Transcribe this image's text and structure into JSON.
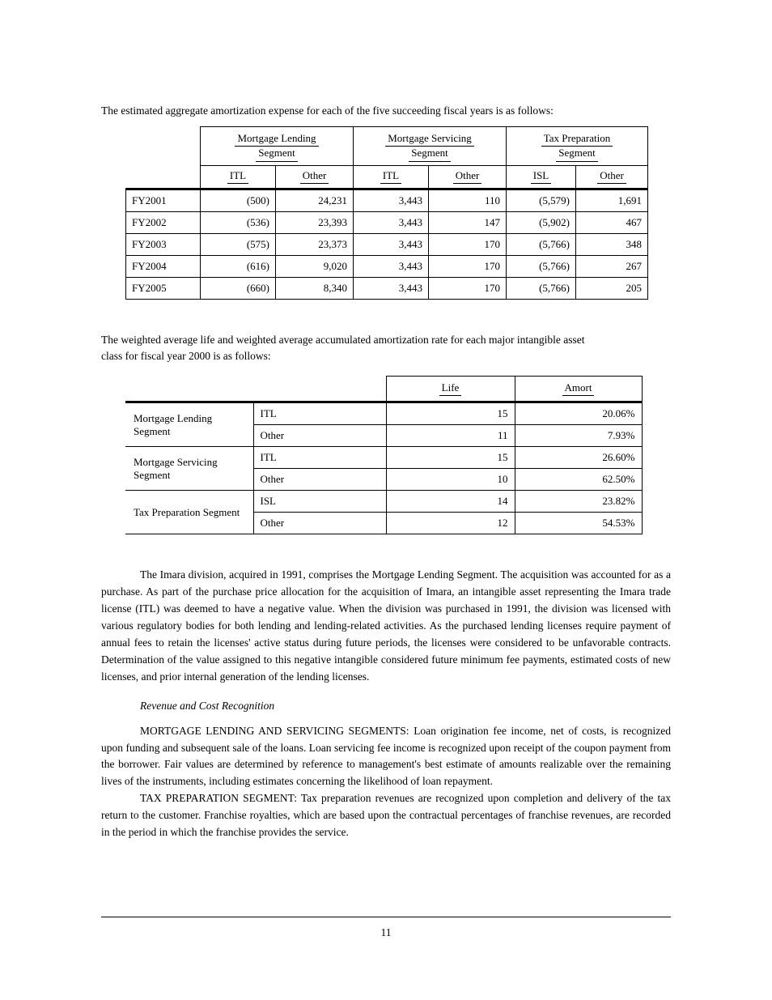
{
  "table1": {
    "title_prefix": "The estimated aggregate amortization expense for each of the five succeeding fiscal years is as follows:",
    "groups": [
      {
        "l1": "Mortgage Lending",
        "l2": "Segment"
      },
      {
        "l1": "Mortgage Servicing",
        "l2": "Segment"
      },
      {
        "l1": "Tax Preparation",
        "l2": "Segment"
      }
    ],
    "sub": [
      "ITL",
      "Other",
      "ITL",
      "Other",
      "ISL",
      "Other"
    ],
    "rows": [
      {
        "label": "FY2001",
        "vals": [
          "(500)",
          "24,231",
          "3,443",
          "110",
          "(5,579)",
          "1,691"
        ]
      },
      {
        "label": "FY2002",
        "vals": [
          "(536)",
          "23,393",
          "3,443",
          "147",
          "(5,902)",
          "467"
        ]
      },
      {
        "label": "FY2003",
        "vals": [
          "(575)",
          "23,373",
          "3,443",
          "170",
          "(5,766)",
          "348"
        ]
      },
      {
        "label": "FY2004",
        "vals": [
          "(616)",
          "9,020",
          "3,443",
          "170",
          "(5,766)",
          "267"
        ]
      },
      {
        "label": "FY2005",
        "vals": [
          "(660)",
          "8,340",
          "3,443",
          "170",
          "(5,766)",
          "205"
        ]
      }
    ]
  },
  "table2": {
    "title_prefix": "The weighted average life and weighted average accumulated amortization rate for each major intangible asset",
    "title_cont": "class for fiscal year 2000 is as follows:",
    "h": [
      "Life",
      "Amort"
    ],
    "rows": [
      {
        "group": "Mortgage Lending Segment",
        "cat": "ITL",
        "life": "15",
        "amort": "20.06%"
      },
      {
        "group": "",
        "cat": "Other",
        "life": "11",
        "amort": "7.93%"
      },
      {
        "group": "Mortgage Servicing Segment",
        "cat": "ITL",
        "life": "15",
        "amort": "26.60%"
      },
      {
        "group": "",
        "cat": "Other",
        "life": "10",
        "amort": "62.50%"
      },
      {
        "group": "Tax Preparation Segment",
        "cat": "ISL",
        "life": "14",
        "amort": "23.82%"
      },
      {
        "group": "",
        "cat": "Other",
        "life": "12",
        "amort": "54.53%"
      }
    ]
  },
  "paras": {
    "p1": "The Imara division, acquired in 1991, comprises the Mortgage Lending Segment. The acquisition was accounted for as a purchase. As part of the purchase price allocation for the acquisition of Imara, an intangible asset representing the Imara trade license (ITL) was deemed to have a negative value. When the division was purchased in 1991, the division was licensed with various regulatory bodies for both lending and lending-related activities. As the purchased lending licenses require payment of annual fees to retain the licenses' active status during future periods, the licenses were considered to be unfavorable contracts. Determination of the value assigned to this negative intangible considered future minimum fee payments, estimated costs of new licenses, and prior internal generation of the lending licenses.",
    "section_head": "Revenue and Cost Recognition",
    "p2a": "MORTGAGE LENDING AND SERVICING SEGMENTS: ",
    "p2b": "Loan origination fee income, net of costs, is recognized upon funding and subsequent sale of the loans. Loan servicing fee income is recognized upon receipt of the coupon payment from the borrower. Fair values are determined by reference to management's best estimate of amounts realizable over the remaining lives of the instruments, including estimates concerning the likelihood of loan repayment.",
    "p3a": "TAX PREPARATION SEGMENT: ",
    "p3b": "Tax preparation revenues are recognized upon completion and delivery of the tax return to the customer. Franchise royalties, which are based upon the contractual percentages of franchise revenues, are recorded in the period in which the franchise provides the service."
  },
  "page_number": "11"
}
